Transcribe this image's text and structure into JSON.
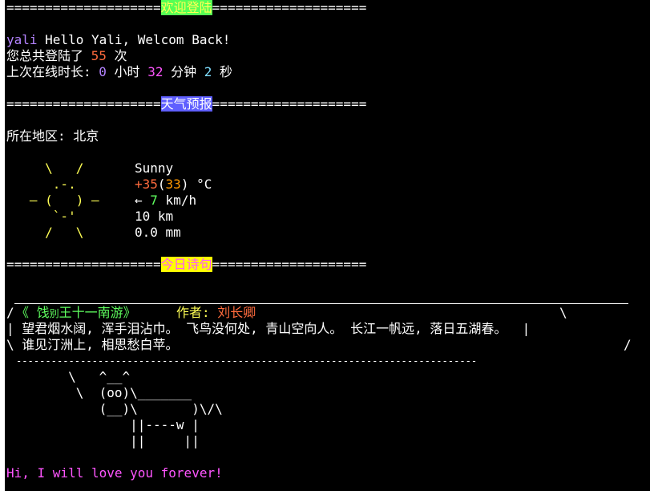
{
  "welcome": {
    "rule_left": "====================",
    "title": "欢迎登陆",
    "rule_right": "====================",
    "username": "yali",
    "greeting": " Hello Yali, Welcom Back!",
    "login_prefix": "您总共登陆了 ",
    "login_count": "55",
    "login_suffix": " 次",
    "online_prefix": "上次在线时长: ",
    "hours": "0",
    "hours_unit": " 小时 ",
    "minutes": "32",
    "minutes_unit": " 分钟 ",
    "seconds": "2",
    "seconds_unit": " 秒"
  },
  "weather": {
    "rule_left": "====================",
    "title": "天气预报",
    "rule_right": "====================",
    "location_label": "所在地区: 北京",
    "art": [
      "     \\   /     ",
      "      .-.      ",
      "   ― (   ) ―   ",
      "      `-'      ",
      "     /   \\     "
    ],
    "condition": "Sunny",
    "temp_main": "+35",
    "temp_open": "(",
    "temp_feels": "33",
    "temp_close": ")",
    "temp_unit": " °C",
    "wind_arrow": "←",
    "wind_speed": "7",
    "wind_unit": " km/h",
    "visibility": "10 km",
    "precipitation": "0.0 mm"
  },
  "poem": {
    "rule_left": "====================",
    "title": "今日诗句",
    "rule_right": "====================",
    "open_quote": "《 饯",
    "small_char": "别",
    "title_rest": "王十一南游》",
    "author_label": "作者: ",
    "author": "刘长卿",
    "line1": "| 望君烟水阔, 浑手泪沾巾。 飞鸟没何处, 青山空向人。 长江一帆远, 落日五湖春。  |",
    "line2": "\\ 谁见汀洲上, 相思愁白苹。",
    "left_slash": "/",
    "right_backslash": "\\",
    "right_slash": "/",
    "dashes": "-------------------------------------------------------------------------------"
  },
  "cow": [
    "        \\   ^__^",
    "         \\  (oo)\\_______",
    "            (__)\\       )\\/\\",
    "                ||----w |",
    "                ||     ||"
  ],
  "footer": {
    "message": "Hi, I will love you forever!"
  },
  "colors": {
    "background": "#000000",
    "welcome_banner": "#55ff55",
    "weather_banner": "#5f5fff",
    "poem_banner": "#ffff00",
    "accent_purple": "#ff55ff"
  }
}
